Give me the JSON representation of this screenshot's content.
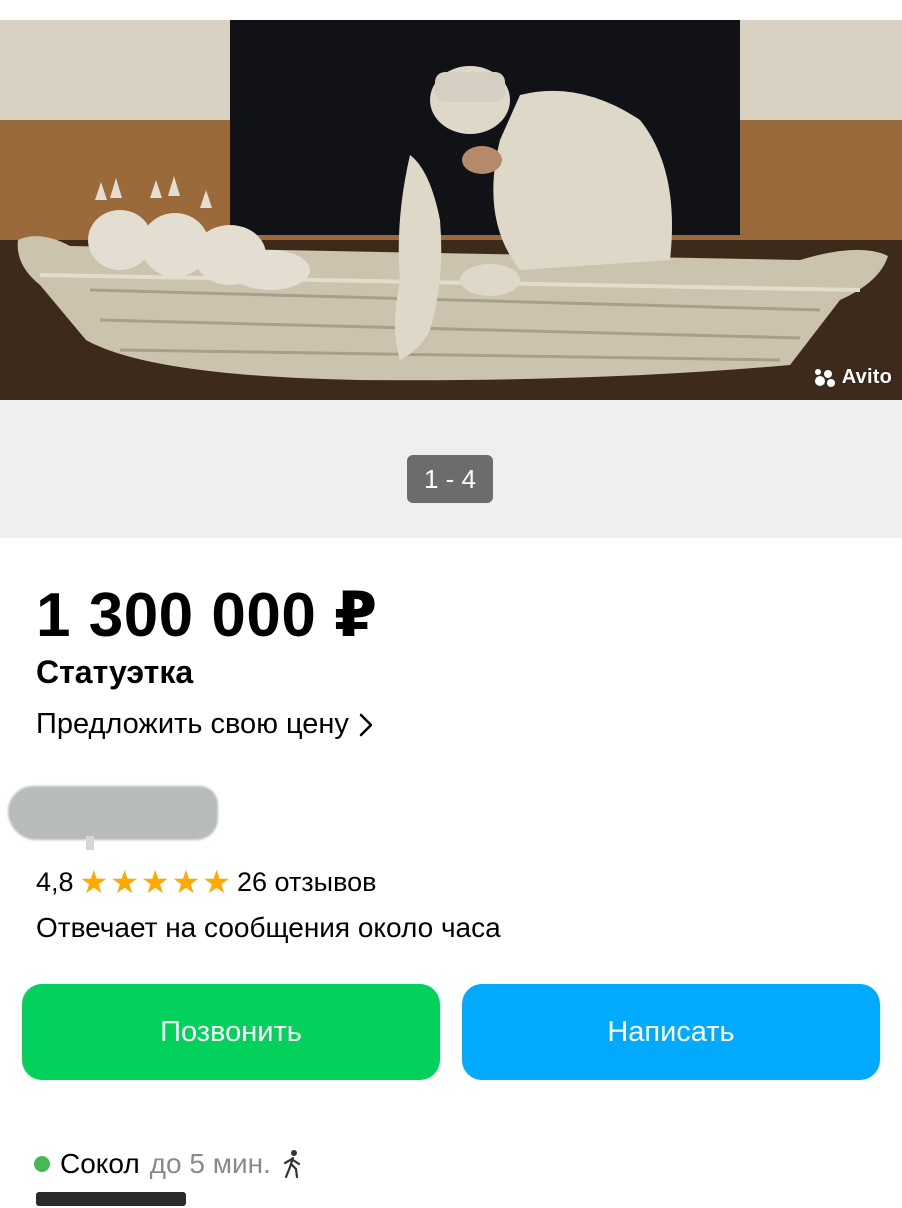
{
  "gallery": {
    "counter": "1 - 4",
    "watermark": "Avito",
    "colors": {
      "strip": "#efefef",
      "counter_bg": "#6c6c6c"
    }
  },
  "listing": {
    "price": "1 300 000 ₽",
    "title": "Статуэтка",
    "offer_price_label": "Предложить свою цену"
  },
  "seller": {
    "rating": "4,8",
    "stars": 5,
    "reviews": "26 отзывов",
    "response_time": "Отвечает на сообщения около часа"
  },
  "actions": {
    "call_label": "Позвонить",
    "write_label": "Написать",
    "colors": {
      "call": "#02d15c",
      "write": "#00aaff"
    }
  },
  "location": {
    "metro": "Сокол",
    "walk_time": "до 5 мин.",
    "metro_color": "#48b855",
    "icon": "walking-person-icon"
  }
}
